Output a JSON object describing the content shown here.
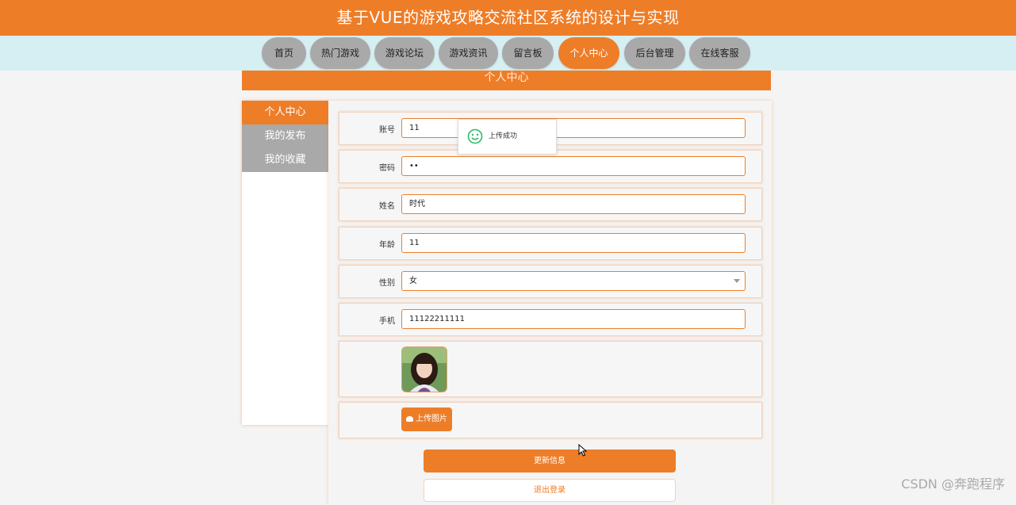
{
  "header": {
    "title": "基于VUE的游戏攻略交流社区系统的设计与实现"
  },
  "nav": {
    "items": [
      {
        "label": "首页",
        "active": false
      },
      {
        "label": "热门游戏",
        "active": false
      },
      {
        "label": "游戏论坛",
        "active": false
      },
      {
        "label": "游戏资讯",
        "active": false
      },
      {
        "label": "留言板",
        "active": false
      },
      {
        "label": "个人中心",
        "active": true
      },
      {
        "label": "后台管理",
        "active": false
      },
      {
        "label": "在线客服",
        "active": false
      }
    ]
  },
  "section": {
    "title": "个人中心"
  },
  "sidebar": {
    "items": [
      {
        "label": "个人中心",
        "active": true
      },
      {
        "label": "我的发布",
        "active": false
      },
      {
        "label": "我的收藏",
        "active": false
      }
    ]
  },
  "form": {
    "account": {
      "label": "账号",
      "value": "11"
    },
    "password": {
      "label": "密码",
      "value": "••"
    },
    "name": {
      "label": "姓名",
      "value": "时代"
    },
    "age": {
      "label": "年龄",
      "value": "11"
    },
    "gender": {
      "label": "性别",
      "value": "女"
    },
    "phone": {
      "label": "手机",
      "value": "11122211111"
    },
    "upload_label": "上传图片",
    "update_label": "更新信息",
    "logout_label": "退出登录"
  },
  "toast": {
    "message": "上传成功",
    "icon": "smiley-icon"
  },
  "watermark": "CSDN @奔跑程序",
  "colors": {
    "accent": "#ee7d28",
    "nav_bg": "#d6eff2",
    "inactive": "#a9a9a9",
    "success": "#2dbb6b"
  }
}
